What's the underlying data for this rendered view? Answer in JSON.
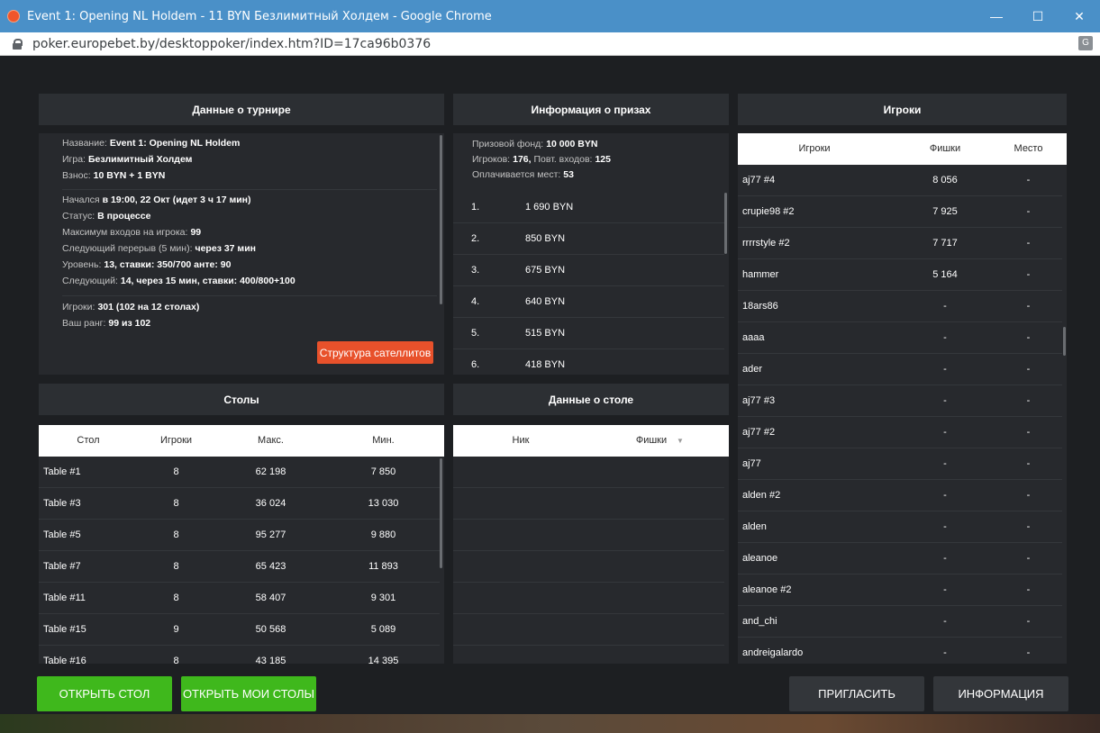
{
  "window": {
    "title": "Event 1: Opening NL Holdem - 11 BYN Безлимитный Холдем - Google Chrome",
    "url": "poker.europebet.by/desktoppoker/index.htm?ID=17ca96b0376"
  },
  "tournament": {
    "header": "Данные о турнире",
    "lines": [
      {
        "label": "Название:",
        "value": "Event 1: Opening NL Holdem"
      },
      {
        "label": "Игра:",
        "value": "Безлимитный Холдем"
      },
      {
        "label": "Взнос:",
        "value": "10 BYN + 1 BYN"
      },
      {
        "label": "Начался",
        "value": "в 19:00, 22 Окт (идет 3 ч 17 мин)"
      },
      {
        "label": "Статус:",
        "value": "В процессе"
      },
      {
        "label": "Максимум входов на игрока:",
        "value": "99"
      },
      {
        "label": "Следующий перерыв (5 мин):",
        "value": "через 37 мин"
      },
      {
        "label": "Уровень:",
        "value": "13, ставки: 350/700 анте: 90"
      },
      {
        "label": "Следующий:",
        "value": "14, через 15 мин, ставки: 400/800+100"
      },
      {
        "label": "Игроки:",
        "value": "301 (102 на 12 столах)"
      },
      {
        "label": "Ваш ранг:",
        "value": "99 из 102"
      }
    ],
    "satellite_button": "Структура сателлитов"
  },
  "prizes": {
    "header": "Информация о призах",
    "pool_label": "Призовой фонд:",
    "pool_value": "10 000 BYN",
    "players_label": "Игроков:",
    "players_value": "176,",
    "reentries_label": "Повт. входов:",
    "reentries_value": "125",
    "paid_label": "Оплачивается мест:",
    "paid_value": "53",
    "rows": [
      {
        "place": "1.",
        "amount": "1 690 BYN"
      },
      {
        "place": "2.",
        "amount": "850 BYN"
      },
      {
        "place": "3.",
        "amount": "675 BYN"
      },
      {
        "place": "4.",
        "amount": "640 BYN"
      },
      {
        "place": "5.",
        "amount": "515 BYN"
      },
      {
        "place": "6.",
        "amount": "418 BYN"
      }
    ]
  },
  "players": {
    "header": "Игроки",
    "columns": [
      "Игроки",
      "Фишки",
      "Место"
    ],
    "rows": [
      {
        "name": "aj77 #4",
        "chips": "8 056",
        "place": "-"
      },
      {
        "name": "crupie98 #2",
        "chips": "7 925",
        "place": "-"
      },
      {
        "name": "rrrrstyle #2",
        "chips": "7 717",
        "place": "-"
      },
      {
        "name": "hammer",
        "chips": "5 164",
        "place": "-"
      },
      {
        "name": "18ars86",
        "chips": "-",
        "place": "-"
      },
      {
        "name": "aaaa",
        "chips": "-",
        "place": "-"
      },
      {
        "name": "ader",
        "chips": "-",
        "place": "-"
      },
      {
        "name": "aj77 #3",
        "chips": "-",
        "place": "-"
      },
      {
        "name": "aj77 #2",
        "chips": "-",
        "place": "-"
      },
      {
        "name": "aj77",
        "chips": "-",
        "place": "-"
      },
      {
        "name": "alden #2",
        "chips": "-",
        "place": "-"
      },
      {
        "name": "alden",
        "chips": "-",
        "place": "-"
      },
      {
        "name": "aleanoe",
        "chips": "-",
        "place": "-"
      },
      {
        "name": "aleanoe #2",
        "chips": "-",
        "place": "-"
      },
      {
        "name": "and_chi",
        "chips": "-",
        "place": "-"
      },
      {
        "name": "andreigalardo",
        "chips": "-",
        "place": "-"
      }
    ]
  },
  "tables": {
    "header": "Столы",
    "columns": [
      "Стол",
      "Игроки",
      "Макс.",
      "Мин."
    ],
    "rows": [
      {
        "name": "Table #1",
        "players": "8",
        "max": "62 198",
        "min": "7 850"
      },
      {
        "name": "Table #3",
        "players": "8",
        "max": "36 024",
        "min": "13 030"
      },
      {
        "name": "Table #5",
        "players": "8",
        "max": "95 277",
        "min": "9 880"
      },
      {
        "name": "Table #7",
        "players": "8",
        "max": "65 423",
        "min": "11 893"
      },
      {
        "name": "Table #11",
        "players": "8",
        "max": "58 407",
        "min": "9 301"
      },
      {
        "name": "Table #15",
        "players": "9",
        "max": "50 568",
        "min": "5 089"
      },
      {
        "name": "Table #16",
        "players": "8",
        "max": "43 185",
        "min": "14 395"
      }
    ]
  },
  "table_data": {
    "header": "Данные о столе",
    "col_nick": "Ник",
    "col_chips": "Фишки"
  },
  "buttons": {
    "open_table": "ОТКРЫТЬ СТОЛ",
    "open_my_tables": "ОТКРЫТЬ МОИ СТОЛЫ",
    "invite": "ПРИГЛАСИТЬ",
    "info": "ИНФОРМАЦИЯ"
  }
}
